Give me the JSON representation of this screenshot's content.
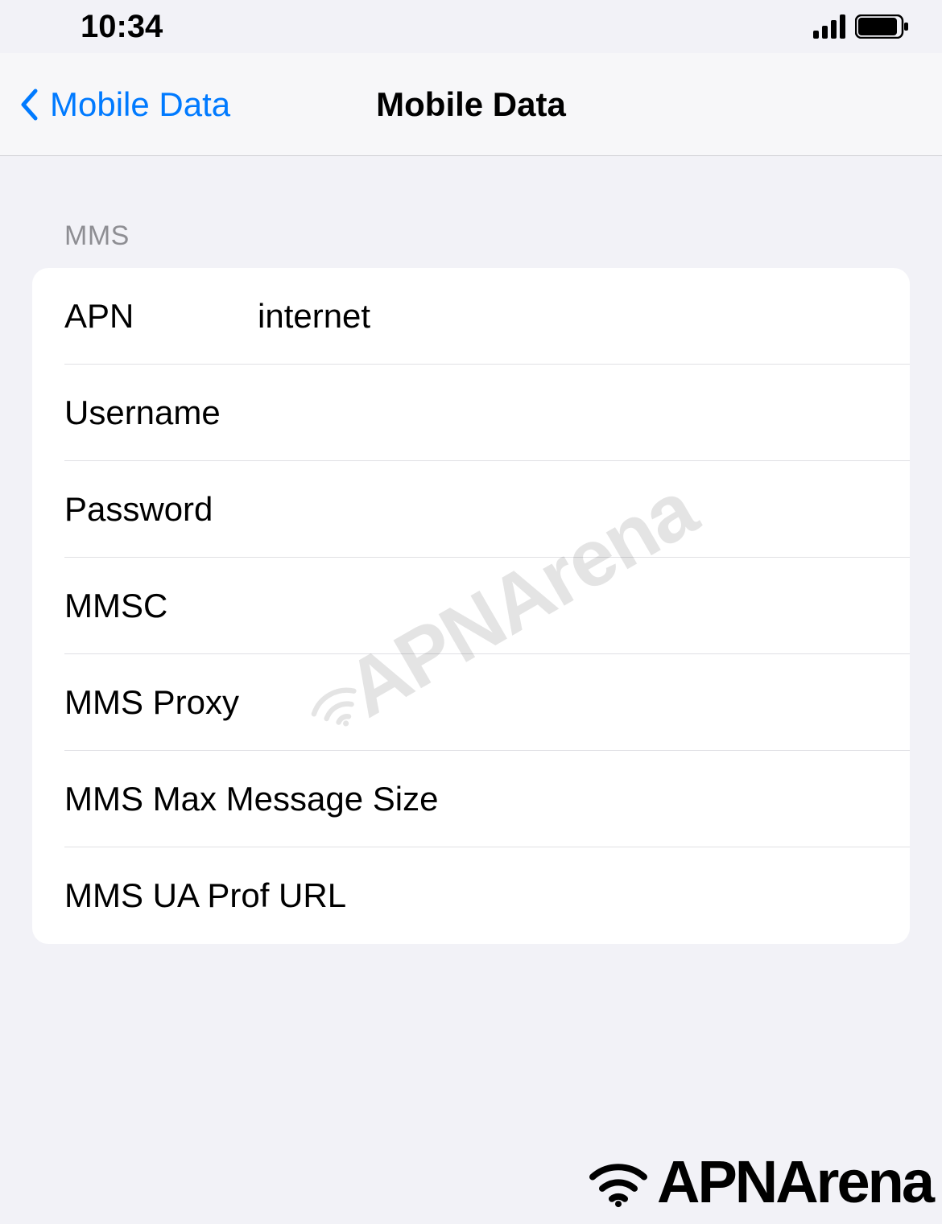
{
  "statusBar": {
    "time": "10:34"
  },
  "nav": {
    "back": "Mobile Data",
    "title": "Mobile Data"
  },
  "section": {
    "header": "MMS",
    "rows": [
      {
        "label": "APN",
        "value": "internet",
        "wide": false
      },
      {
        "label": "Username",
        "value": "",
        "wide": false
      },
      {
        "label": "Password",
        "value": "",
        "wide": false
      },
      {
        "label": "MMSC",
        "value": "",
        "wide": false
      },
      {
        "label": "MMS Proxy",
        "value": "",
        "wide": false
      },
      {
        "label": "MMS Max Message Size",
        "value": "",
        "wide": true
      },
      {
        "label": "MMS UA Prof URL",
        "value": "",
        "wide": true
      }
    ]
  },
  "watermark": {
    "text": "APNArena",
    "footerText": "APNArena"
  }
}
